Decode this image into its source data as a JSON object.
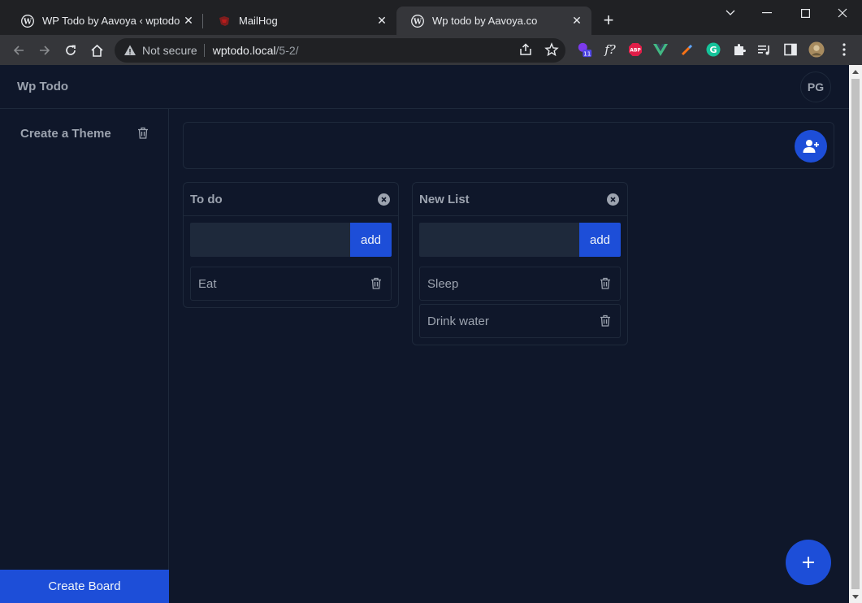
{
  "browser": {
    "tabs": [
      {
        "title": "WP Todo by Aavoya ‹ wptodo —",
        "icon": "wordpress-icon",
        "active": false
      },
      {
        "title": "MailHog",
        "icon": "mailhog-icon",
        "active": false
      },
      {
        "title": "Wp todo by Aavoya.co",
        "icon": "wordpress-icon",
        "active": true
      }
    ],
    "address": {
      "security_label": "Not secure",
      "host": "wptodo.local",
      "path": "/5-2/"
    },
    "extensions": [
      {
        "name": "extension-badge-icon",
        "badge": "11"
      },
      {
        "name": "font-finder-icon",
        "label": "f?"
      },
      {
        "name": "adblock-icon",
        "label": "ABP"
      },
      {
        "name": "vue-devtools-icon"
      },
      {
        "name": "color-picker-icon"
      },
      {
        "name": "grammarly-icon",
        "label": "G"
      },
      {
        "name": "puzzle-icon"
      },
      {
        "name": "media-control-icon"
      },
      {
        "name": "side-panel-icon"
      },
      {
        "name": "profile-avatar-icon"
      },
      {
        "name": "kebab-menu-icon"
      }
    ]
  },
  "app": {
    "brand": "Wp Todo",
    "avatar_initials": "PG",
    "sidebar": {
      "boards": [
        {
          "name": "Create a Theme"
        }
      ],
      "create_board_label": "Create Board"
    },
    "lists": [
      {
        "title": "To do",
        "input_value": "",
        "add_label": "add",
        "tasks": [
          {
            "text": "Eat"
          }
        ]
      },
      {
        "title": "New List",
        "input_value": "",
        "add_label": "add",
        "tasks": [
          {
            "text": "Sleep"
          },
          {
            "text": "Drink water"
          }
        ]
      }
    ]
  },
  "colors": {
    "background": "#0f172a",
    "border": "#1e293b",
    "accent": "#1d4ed8",
    "muted_text": "#9ca3af"
  }
}
